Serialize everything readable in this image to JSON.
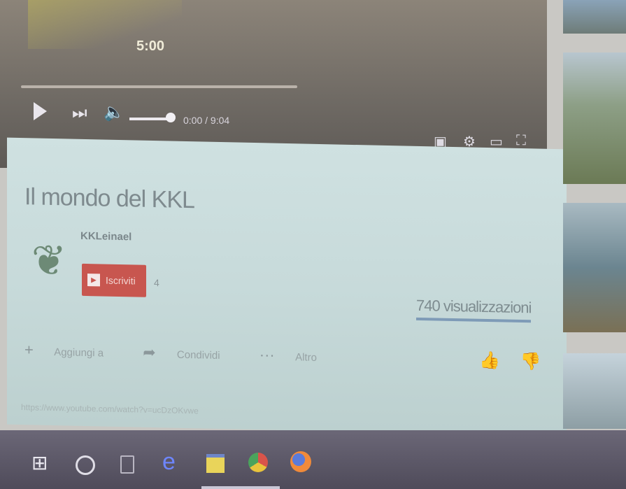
{
  "player": {
    "overlay_time": "5:00",
    "time_display": "0:00 / 9:04",
    "icons": {
      "play": "play-icon",
      "next": "skip-next-icon",
      "volume": "volume-icon",
      "subtitles": "subtitles-icon",
      "settings": "gear-icon",
      "theater": "theater-mode-icon",
      "fullscreen": "fullscreen-icon"
    }
  },
  "video": {
    "title": "Il mondo del KKL",
    "channel": "KKLeinael",
    "subscribe_label": "Iscriviti",
    "subscriber_count": "4",
    "views": "740 visualizzazioni",
    "actions": {
      "add": "Aggiungi a",
      "share": "Condividi",
      "more": "Altro"
    },
    "url": "https://www.youtube.com/watch?v=ucDzOKvwe"
  },
  "taskbar": {
    "icons": [
      "windows-start-icon",
      "cortana-icon",
      "task-view-icon",
      "edge-icon",
      "file-explorer-icon",
      "chrome-icon",
      "firefox-icon"
    ]
  },
  "colors": {
    "subscribe": "#c8564f",
    "views_underline": "#7e9bb7",
    "edge": "#6e86ff"
  }
}
